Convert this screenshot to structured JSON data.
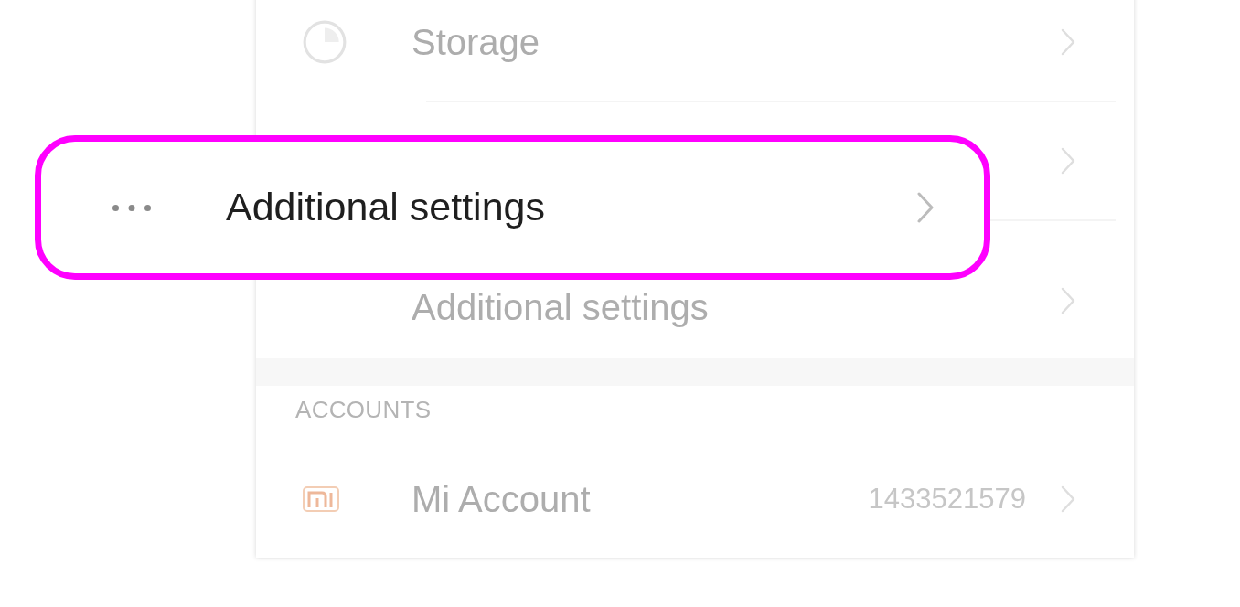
{
  "settings_list": {
    "items": [
      {
        "kind": "row",
        "label": "Storage"
      },
      {
        "kind": "row"
      },
      {
        "kind": "row",
        "label": "Additional settings"
      },
      {
        "kind": "gap"
      },
      {
        "kind": "header",
        "label": "ACCOUNTS"
      },
      {
        "kind": "row",
        "label": "Mi Account",
        "value": "1433521579"
      }
    ]
  },
  "callout": {
    "label": "Additional settings"
  }
}
